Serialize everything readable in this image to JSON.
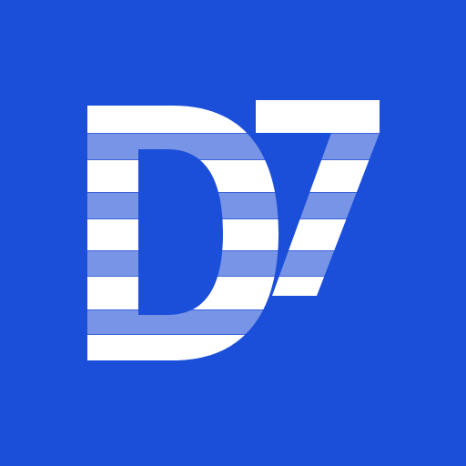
{
  "logo": {
    "text": "D7",
    "colors": {
      "background": "#1c4fd9",
      "glyph": "#ffffff",
      "stripe": "#7894e6",
      "stripe_line": "#3d66db"
    }
  }
}
